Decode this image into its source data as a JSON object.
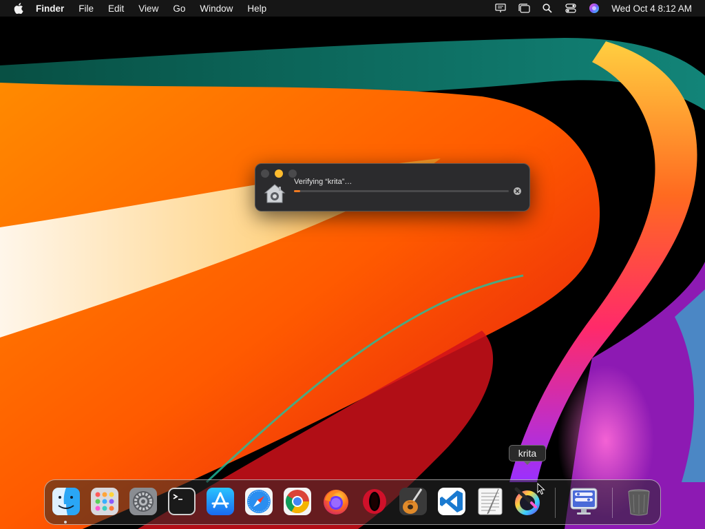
{
  "menubar": {
    "app_name": "Finder",
    "menus": [
      "File",
      "Edit",
      "View",
      "Go",
      "Window",
      "Help"
    ],
    "clock": "Wed Oct 4  8:12 AM"
  },
  "verify_window": {
    "message": "Verifying “krita”…",
    "progress": 0.03,
    "accent_color": "#f07a22"
  },
  "tooltip": {
    "label": "krita"
  },
  "dock": {
    "apps": [
      {
        "name": "Finder",
        "icon": "finder-icon",
        "running": true
      },
      {
        "name": "Launchpad",
        "icon": "launchpad-icon"
      },
      {
        "name": "System Settings",
        "icon": "system-settings-icon"
      },
      {
        "name": "Terminal",
        "icon": "terminal-icon"
      },
      {
        "name": "App Store",
        "icon": "app-store-icon"
      },
      {
        "name": "Safari",
        "icon": "safari-icon"
      },
      {
        "name": "Google Chrome",
        "icon": "chrome-icon"
      },
      {
        "name": "Firefox",
        "icon": "firefox-icon"
      },
      {
        "name": "Opera",
        "icon": "opera-icon"
      },
      {
        "name": "GarageBand",
        "icon": "garageband-icon"
      },
      {
        "name": "Visual Studio Code",
        "icon": "vscode-icon"
      },
      {
        "name": "TextEdit",
        "icon": "textedit-icon"
      },
      {
        "name": "krita",
        "icon": "krita-icon"
      },
      {
        "name": "Remote Desktop",
        "icon": "remote-desktop-icon"
      },
      {
        "name": "Trash",
        "icon": "trash-icon"
      }
    ]
  }
}
